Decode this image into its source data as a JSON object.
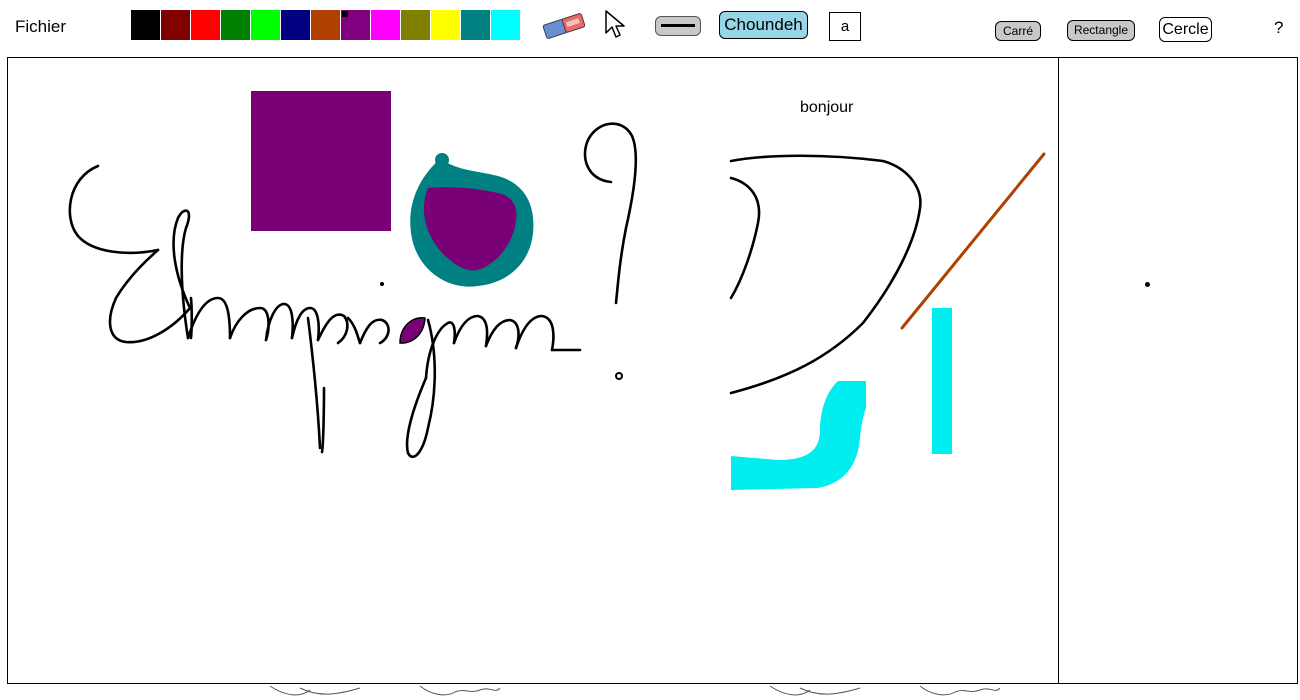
{
  "menu": {
    "file_label": "Fichier"
  },
  "palette": {
    "colors": [
      "#000000",
      "#800000",
      "#ff0000",
      "#008000",
      "#00ff00",
      "#000080",
      "#b04000",
      "#800080",
      "#ff00ff",
      "#808000",
      "#ffff00",
      "#008080",
      "#00ffff"
    ],
    "selected_index": 7
  },
  "toolbar": {
    "eraser_icon": "eraser-icon",
    "cursor_icon": "pointer-cursor-icon",
    "line_icon": "line-thickness-icon",
    "font_label": "Choundeh",
    "text_tool_label": "a",
    "square_label": "Carré",
    "rectangle_label": "Rectangle",
    "circle_label": "Cercle",
    "help_label": "?"
  },
  "canvas": {
    "text_label": "bonjour",
    "handwriting": "Champignon?",
    "colors": {
      "stroke": "#000000",
      "purple": "#7a0078",
      "teal": "#008080",
      "cyan": "#00eef0",
      "orange": "#b04000"
    }
  }
}
